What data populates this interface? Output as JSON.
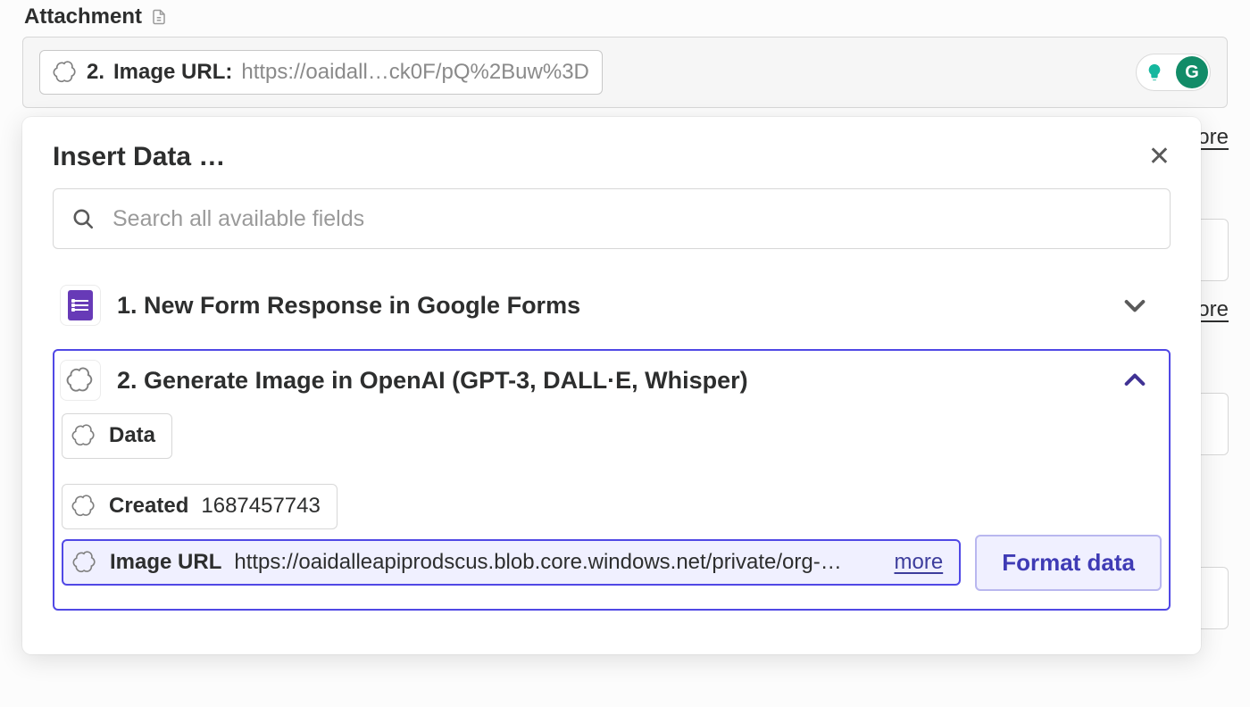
{
  "field": {
    "label": "Attachment"
  },
  "attachment_token": {
    "step": "2.",
    "label": "Image URL:",
    "value": "https://oaidall…ck0F/pQ%2Buw%3D"
  },
  "right_links": {
    "more": "more"
  },
  "popover": {
    "title": "Insert Data …",
    "search_placeholder": "Search all available fields",
    "sources": [
      {
        "id": "google-forms",
        "title": "1. New Form Response in Google Forms",
        "expanded": false
      },
      {
        "id": "openai",
        "title": "2. Generate Image in OpenAI (GPT-3, DALL·E, Whisper)",
        "expanded": true,
        "fields": [
          {
            "label": "Data",
            "value": ""
          },
          {
            "label": "Created",
            "value": "1687457743"
          }
        ],
        "selected_field": {
          "label": "Image URL",
          "value": "https://oaidalleapiprodscus.blob.core.windows.net/private/org-…",
          "more": "more"
        },
        "format_button": "Format data"
      }
    ]
  }
}
